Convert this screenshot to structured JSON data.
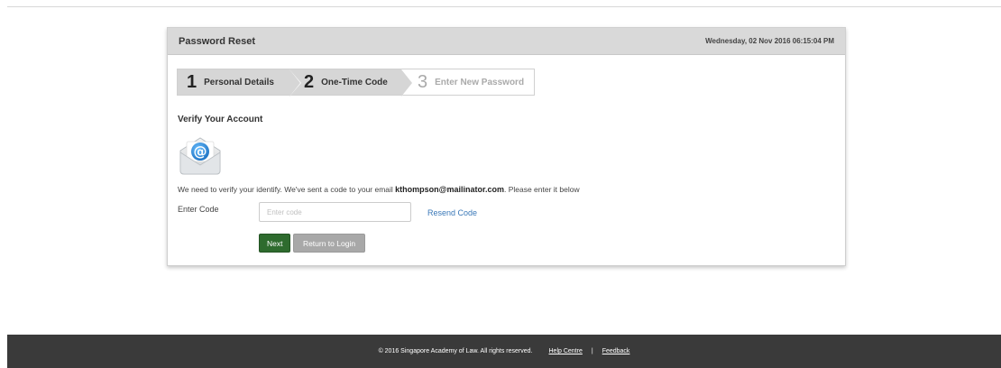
{
  "header": {
    "title": "Password Reset",
    "datetime": "Wednesday, 02 Nov 2016 06:15:04 PM"
  },
  "steps": [
    {
      "number": "1",
      "label": "Personal Details",
      "state": "done"
    },
    {
      "number": "2",
      "label": "One-Time Code",
      "state": "done"
    },
    {
      "number": "3",
      "label": "Enter New Password",
      "state": "todo"
    }
  ],
  "verify": {
    "title": "Verify Your Account",
    "icon": "email-icon",
    "message_before": "We need to verify your identify. We've sent a code to your email ",
    "email": "kthompson@mailinator.com",
    "message_after": ". Please enter it below",
    "code_label": "Enter Code",
    "code_placeholder": "Enter code",
    "code_value": "",
    "resend_label": "Resend Code",
    "next_label": "Next",
    "return_label": "Return to Login"
  },
  "footer": {
    "copyright": "© 2016 Singapore Academy of Law. All rights reserved.",
    "help_label": "Help Centre",
    "separator": "|",
    "feedback_label": "Feedback"
  },
  "colors": {
    "next_button": "#2e6b2e",
    "return_button": "#a8a8a8",
    "link": "#3a78b8",
    "footer_bg": "#3a3a3a",
    "header_bg": "#d9d9d9"
  }
}
